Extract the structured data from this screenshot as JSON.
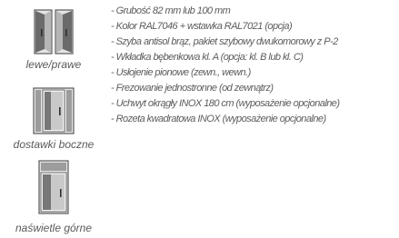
{
  "icons": [
    {
      "caption": "lewe/prawe",
      "icon": "double-door-icon"
    },
    {
      "caption": "dostawki boczne",
      "icon": "door-with-side-panels-icon"
    },
    {
      "caption": "naświetle górne",
      "icon": "door-with-top-light-icon"
    }
  ],
  "specs": [
    "- Grubość 82 mm lub 100 mm",
    "- Kolor RAL7046 + wstawka RAL7021 (opcja)",
    "- Szyba antisol brąz, pakiet szybowy dwukomorowy z P-2",
    "- Wkładka bębenkowa kl. A (opcja: kl. B lub kl. C)",
    "- Usłojenie pionowe (zewn., wewn.)",
    "- Frezowanie jednostronne (od zewnątrz)",
    "- Uchwyt okrągły INOX 180 cm (wyposażenie opcjonalne)",
    "- Rozeta kwadratowa INOX (wyposażenie opcjonalne)"
  ],
  "colors": {
    "icon_dark": "#555555",
    "icon_mid": "#9a9a9a",
    "icon_light": "#e2e2e2",
    "text": "#5c5c5c"
  }
}
